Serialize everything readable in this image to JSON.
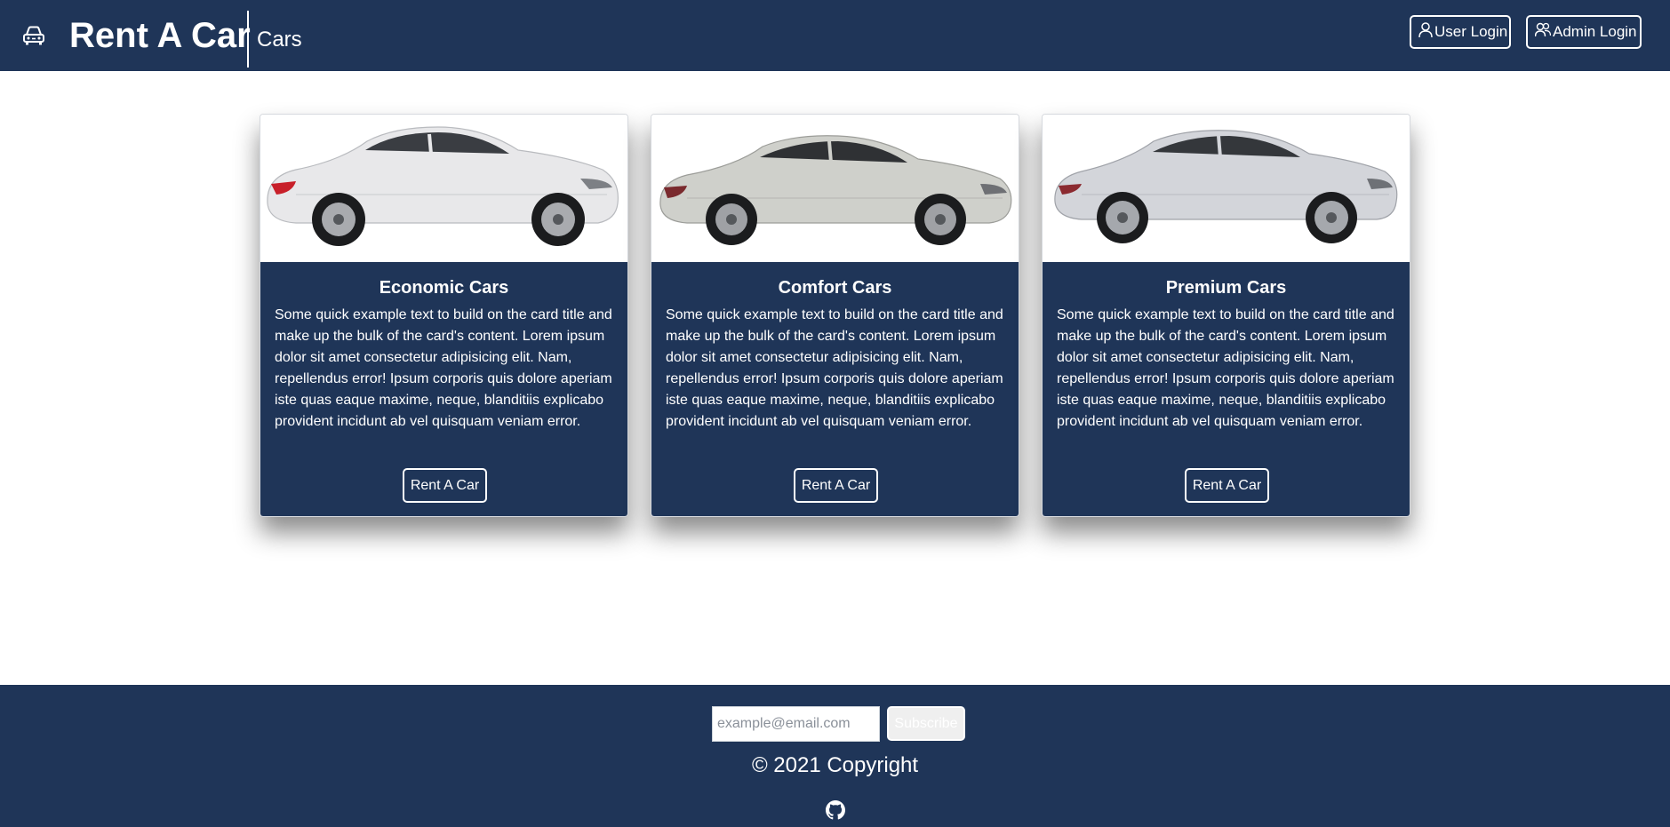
{
  "navbar": {
    "brand_icon": "car-icon",
    "brand_title": "Rent A Car",
    "brand_subtitle": "Cars",
    "user_login_label": "User Login",
    "user_login_icon": "person-icon",
    "admin_login_label": "Admin Login",
    "admin_login_icon": "people-icon"
  },
  "cards": [
    {
      "title": "Economic Cars",
      "text": "Some quick example text to build on the card title and make up the bulk of the card's content. Lorem ipsum dolor sit amet consectetur adipisicing elit. Nam, repellendus error! Ipsum corporis quis dolore aperiam iste quas eaque maxime, neque, blanditiis explicabo provident incidunt ab vel quisquam veniam error.",
      "button_label": "Rent A Car",
      "image": "white-sedan-car-image"
    },
    {
      "title": "Comfort Cars",
      "text": "Some quick example text to build on the card title and make up the bulk of the card's content. Lorem ipsum dolor sit amet consectetur adipisicing elit. Nam, repellendus error! Ipsum corporis quis dolore aperiam iste quas eaque maxime, neque, blanditiis explicabo provident incidunt ab vel quisquam veniam error.",
      "button_label": "Rent A Car",
      "image": "silver-sedan-car-image"
    },
    {
      "title": "Premium Cars",
      "text": "Some quick example text to build on the card title and make up the bulk of the card's content. Lorem ipsum dolor sit amet consectetur adipisicing elit. Nam, repellendus error! Ipsum corporis quis dolore aperiam iste quas eaque maxime, neque, blanditiis explicabo provident incidunt ab vel quisquam veniam error.",
      "button_label": "Rent A Car",
      "image": "silver-premium-sedan-car-image"
    }
  ],
  "footer": {
    "email_placeholder": "example@email.com",
    "email_value": "",
    "subscribe_label": "Subscribe",
    "copyright": "© 2021 Copyright",
    "github_icon": "github-icon"
  },
  "colors": {
    "primary": "#1f3558",
    "text_on_primary": "#ffffff",
    "page_background": "#ffffff"
  }
}
